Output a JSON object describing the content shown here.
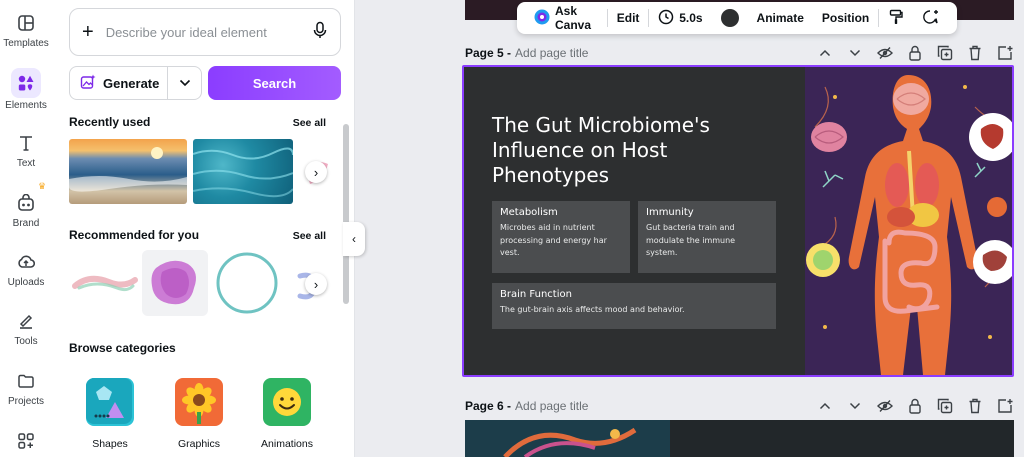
{
  "rail": {
    "items": [
      {
        "label": "Templates",
        "icon": "templates-icon"
      },
      {
        "label": "Elements",
        "icon": "elements-icon"
      },
      {
        "label": "Text",
        "icon": "text-icon"
      },
      {
        "label": "Brand",
        "icon": "brand-icon"
      },
      {
        "label": "Uploads",
        "icon": "uploads-icon"
      },
      {
        "label": "Tools",
        "icon": "tools-icon"
      },
      {
        "label": "Projects",
        "icon": "projects-icon"
      },
      {
        "label": "",
        "icon": "apps-icon"
      }
    ],
    "active": "Elements"
  },
  "panel": {
    "search_placeholder": "Describe your ideal element",
    "generate_label": "Generate",
    "search_label": "Search",
    "recently_used": {
      "title": "Recently used",
      "see_all": "See all"
    },
    "recommended": {
      "title": "Recommended for you",
      "see_all": "See all"
    },
    "browse": {
      "title": "Browse categories",
      "categories": [
        {
          "label": "Shapes",
          "icon": "shapes-icon"
        },
        {
          "label": "Graphics",
          "icon": "graphics-icon"
        },
        {
          "label": "Animations",
          "icon": "animations-icon"
        }
      ]
    }
  },
  "toolbar": {
    "ask_canva": "Ask Canva",
    "edit": "Edit",
    "duration": "5.0s",
    "animate": "Animate",
    "position": "Position",
    "color": "#2d2f30"
  },
  "pages": [
    {
      "number": "Page 5 -",
      "title_placeholder": "Add page title"
    },
    {
      "number": "Page 6 -",
      "title_placeholder": "Add page title"
    }
  ],
  "slide": {
    "title": "The Gut Microbiome's Influence on Host Phenotypes",
    "cards": [
      {
        "heading": "Metabolism",
        "body": "Microbes aid in nutrient processing and energy har vest."
      },
      {
        "heading": "Immunity",
        "body": "Gut bacteria train and modulate the immune system."
      },
      {
        "heading": "Brain Function",
        "body": "The gut-brain axis affects mood and behavior."
      }
    ]
  },
  "colors": {
    "accent": "#8b3dff",
    "slide_bg": "#2d2f30",
    "card_bg": "#4b4d4f"
  }
}
